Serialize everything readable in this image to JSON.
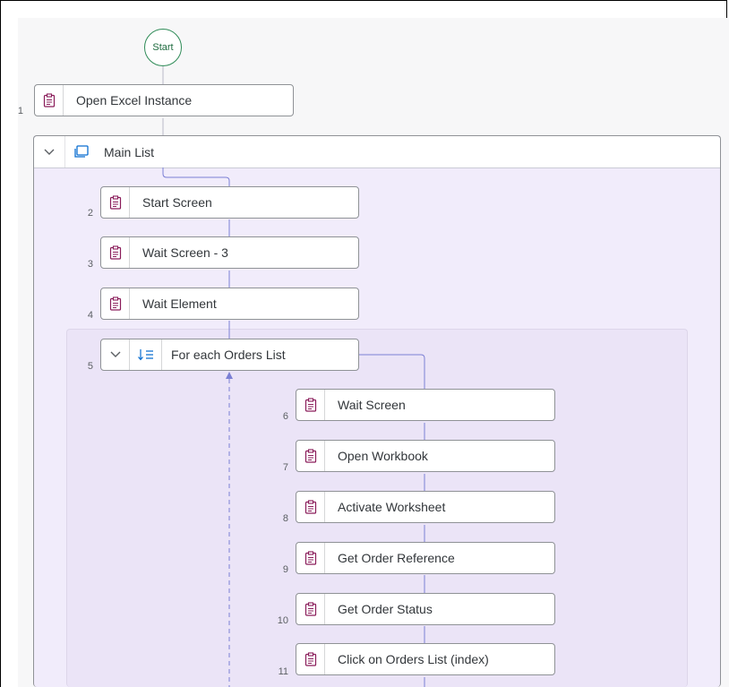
{
  "flow": {
    "start_label": "Start",
    "steps": [
      {
        "number": "1",
        "label": "Open Excel Instance"
      },
      {
        "number": "2",
        "label": "Start Screen"
      },
      {
        "number": "3",
        "label": "Wait Screen - 3"
      },
      {
        "number": "4",
        "label": "Wait Element"
      },
      {
        "number": "5",
        "label": "For each Orders List"
      },
      {
        "number": "6",
        "label": "Wait Screen"
      },
      {
        "number": "7",
        "label": "Open Workbook"
      },
      {
        "number": "8",
        "label": "Activate Worksheet"
      },
      {
        "number": "9",
        "label": "Get Order Reference"
      },
      {
        "number": "10",
        "label": "Get Order Status"
      },
      {
        "number": "11",
        "label": "Click on Orders List (index)"
      }
    ],
    "main_group_label": "Main List"
  },
  "icons": {
    "step": "clipboard-icon",
    "group": "collection-icon",
    "loop": "sort-list-icon",
    "collapse": "chevron-down-icon"
  },
  "colors": {
    "step_icon": "#8a1c5a",
    "start_border": "#2e8b57",
    "connector": "#7b7fd4",
    "main_group_bg": "#f1ecfb",
    "loop_group_bg": "#ebe4f7",
    "loop_icon": "#0a6ed1"
  }
}
